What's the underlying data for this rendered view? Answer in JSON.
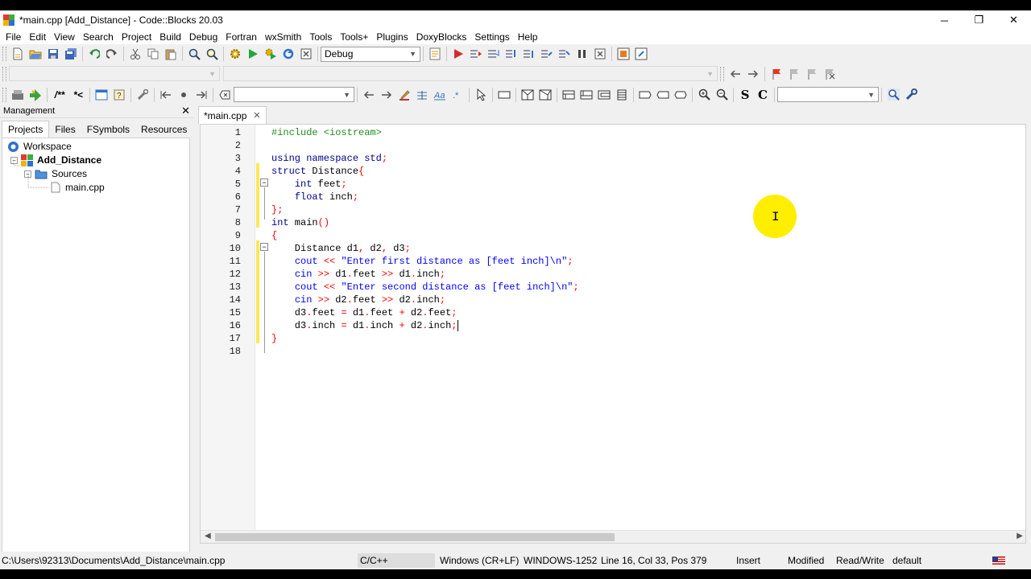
{
  "window": {
    "title": "*main.cpp [Add_Distance] - Code::Blocks 20.03",
    "minimize_glyph": "─",
    "restore_glyph": "❐",
    "close_glyph": "✕"
  },
  "menu": [
    "File",
    "Edit",
    "View",
    "Search",
    "Project",
    "Build",
    "Debug",
    "Fortran",
    "wxSmith",
    "Tools",
    "Tools+",
    "Plugins",
    "DoxyBlocks",
    "Settings",
    "Help"
  ],
  "toolbar": {
    "build_target": "Debug",
    "doxy_comment_labels": [
      "/**",
      "*<"
    ],
    "style_labels": [
      "S",
      "C"
    ]
  },
  "management": {
    "title": "Management",
    "tabs": [
      "Projects",
      "Files",
      "FSymbols",
      "Resources"
    ],
    "tree": {
      "workspace": "Workspace",
      "project": "Add_Distance",
      "folder": "Sources",
      "file": "main.cpp"
    }
  },
  "editor": {
    "tab_label": "*main.cpp",
    "lines": [
      {
        "n": "1",
        "parts": [
          [
            "pp",
            "#include <iostream>"
          ]
        ]
      },
      {
        "n": "2",
        "parts": []
      },
      {
        "n": "3",
        "parts": [
          [
            "kw",
            "using namespace"
          ],
          [
            "",
            " "
          ],
          [
            "kw",
            "std"
          ],
          [
            "op",
            ";"
          ]
        ]
      },
      {
        "n": "4",
        "parts": [
          [
            "kw",
            "struct"
          ],
          [
            "",
            " Distance"
          ],
          [
            "op",
            "{"
          ]
        ]
      },
      {
        "n": "5",
        "parts": [
          [
            "",
            "    "
          ],
          [
            "kw",
            "int"
          ],
          [
            "",
            " feet"
          ],
          [
            "op",
            ";"
          ]
        ]
      },
      {
        "n": "6",
        "parts": [
          [
            "",
            "    "
          ],
          [
            "kw",
            "float"
          ],
          [
            "",
            " inch"
          ],
          [
            "op",
            ";"
          ]
        ]
      },
      {
        "n": "7",
        "parts": [
          [
            "op",
            "};"
          ]
        ]
      },
      {
        "n": "8",
        "parts": [
          [
            "kw",
            "int"
          ],
          [
            "",
            " main"
          ],
          [
            "op",
            "()"
          ]
        ]
      },
      {
        "n": "9",
        "parts": [
          [
            "op",
            "{"
          ]
        ]
      },
      {
        "n": "10",
        "parts": [
          [
            "",
            "    Distance d1"
          ],
          [
            "op",
            ","
          ],
          [
            "",
            " d2"
          ],
          [
            "op",
            ","
          ],
          [
            "",
            " d3"
          ],
          [
            "op",
            ";"
          ]
        ]
      },
      {
        "n": "11",
        "parts": [
          [
            "",
            "    "
          ],
          [
            "str",
            "cout"
          ],
          [
            "",
            " "
          ],
          [
            "op",
            "<<"
          ],
          [
            "",
            " "
          ],
          [
            "str",
            "\"Enter first distance as [feet inch]\\n\""
          ],
          [
            "op",
            ";"
          ]
        ]
      },
      {
        "n": "12",
        "parts": [
          [
            "",
            "    "
          ],
          [
            "str",
            "cin"
          ],
          [
            "",
            " "
          ],
          [
            "op",
            ">>"
          ],
          [
            "",
            " d1"
          ],
          [
            "op",
            "."
          ],
          [
            "",
            "feet "
          ],
          [
            "op",
            ">>"
          ],
          [
            "",
            " d1"
          ],
          [
            "op",
            "."
          ],
          [
            "",
            "inch"
          ],
          [
            "op",
            ";"
          ]
        ]
      },
      {
        "n": "13",
        "parts": [
          [
            "",
            "    "
          ],
          [
            "str",
            "cout"
          ],
          [
            "",
            " "
          ],
          [
            "op",
            "<<"
          ],
          [
            "",
            " "
          ],
          [
            "str",
            "\"Enter second distance as [feet inch]\\n\""
          ],
          [
            "op",
            ";"
          ]
        ]
      },
      {
        "n": "14",
        "parts": [
          [
            "",
            "    "
          ],
          [
            "str",
            "cin"
          ],
          [
            "",
            " "
          ],
          [
            "op",
            ">>"
          ],
          [
            "",
            " d2"
          ],
          [
            "op",
            "."
          ],
          [
            "",
            "feet "
          ],
          [
            "op",
            ">>"
          ],
          [
            "",
            " d2"
          ],
          [
            "op",
            "."
          ],
          [
            "",
            "inch"
          ],
          [
            "op",
            ";"
          ]
        ]
      },
      {
        "n": "15",
        "parts": [
          [
            "",
            "    d3"
          ],
          [
            "op",
            "."
          ],
          [
            "",
            "feet "
          ],
          [
            "op",
            "="
          ],
          [
            "",
            " d1"
          ],
          [
            "op",
            "."
          ],
          [
            "",
            "feet "
          ],
          [
            "op",
            "+"
          ],
          [
            "",
            " d2"
          ],
          [
            "op",
            "."
          ],
          [
            "",
            "feet"
          ],
          [
            "op",
            ";"
          ]
        ]
      },
      {
        "n": "16",
        "parts": [
          [
            "",
            "    d3"
          ],
          [
            "op",
            "."
          ],
          [
            "",
            "inch "
          ],
          [
            "op",
            "="
          ],
          [
            "",
            " d1"
          ],
          [
            "op",
            "."
          ],
          [
            "",
            "inch "
          ],
          [
            "op",
            "+"
          ],
          [
            "",
            " d2"
          ],
          [
            "op",
            "."
          ],
          [
            "",
            "inch"
          ],
          [
            "op",
            ";"
          ]
        ]
      },
      {
        "n": "17",
        "parts": [
          [
            "op",
            "}"
          ]
        ]
      },
      {
        "n": "18",
        "parts": []
      }
    ]
  },
  "status": {
    "path": "C:\\Users\\92313\\Documents\\Add_Distance\\main.cpp",
    "language": "C/C++",
    "line_endings": "Windows (CR+LF)",
    "encoding": "WINDOWS-1252",
    "position": "Line 16, Col 33, Pos 379",
    "mode": "Insert",
    "modified": "Modified",
    "access": "Read/Write",
    "profile": "default"
  },
  "colors": {
    "keyword": "#00008b",
    "preprocessor": "#228b22",
    "string": "#0000ff",
    "operator": "#ff0000",
    "changebar": "#ffe65c",
    "cursor_highlight": "#ffee00"
  }
}
